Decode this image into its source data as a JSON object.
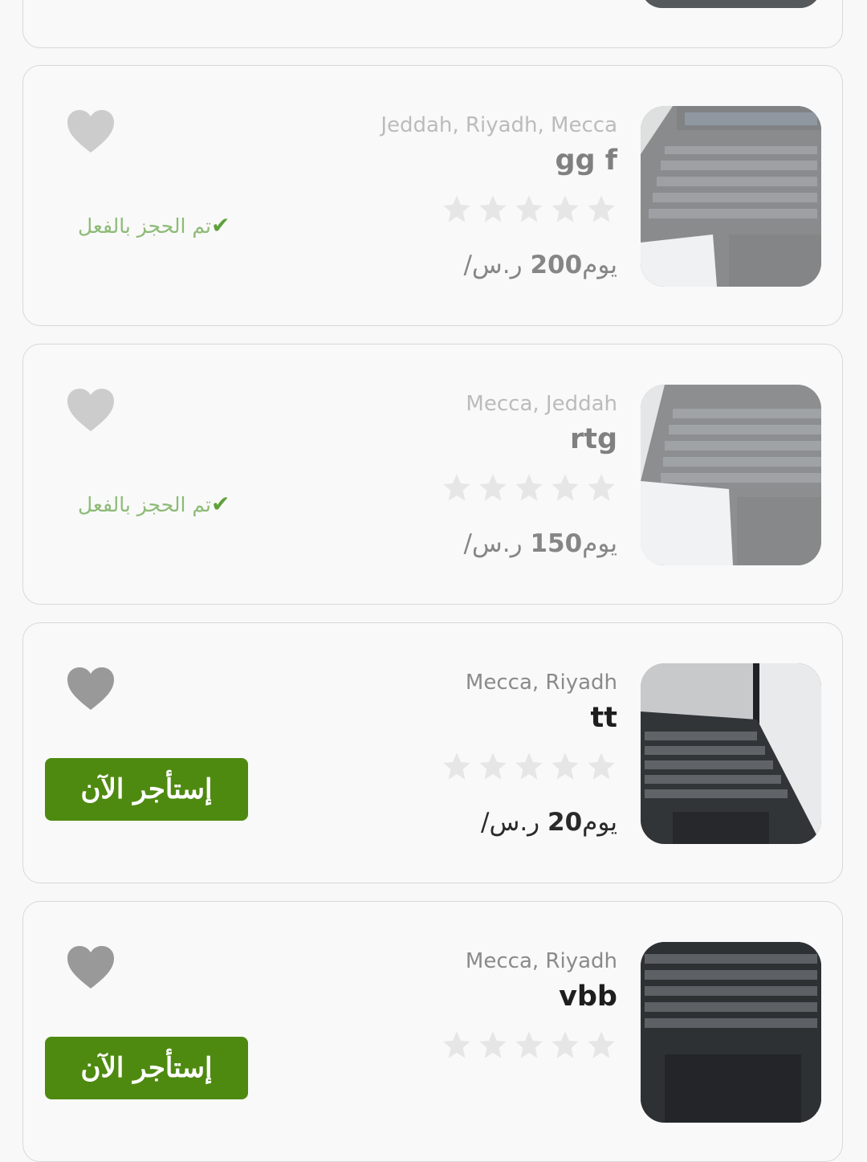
{
  "listings": [
    {
      "location": "Jeddah, Riyadh, Mecca",
      "title": "gg f",
      "rating": 0,
      "currency": "ر.س",
      "price": "200",
      "unit": "/يوم",
      "status": "booked",
      "booked_label": "تم الحجز بالفعل",
      "heart_icon": "heart-icon"
    },
    {
      "location": "Mecca, Jeddah",
      "title": "rtg",
      "rating": 0,
      "currency": "ر.س",
      "price": "150",
      "unit": "/يوم",
      "status": "booked",
      "booked_label": "تم الحجز بالفعل",
      "heart_icon": "heart-icon"
    },
    {
      "location": "Mecca, Riyadh",
      "title": "tt",
      "rating": 0,
      "currency": "ر.س",
      "price": "20",
      "unit": "/يوم",
      "status": "available",
      "button_label": "إستأجر الآن",
      "heart_icon": "heart-icon"
    },
    {
      "location": "Mecca, Riyadh",
      "title": "vbb",
      "rating": 0,
      "status": "available",
      "button_label": "إستأجر الآن",
      "heart_icon": "heart-icon"
    }
  ],
  "colors": {
    "primary_button": "#4e8a10",
    "booked_text": "#8dbb77",
    "heart": "#999999",
    "star_empty": "#e6e6e6"
  }
}
